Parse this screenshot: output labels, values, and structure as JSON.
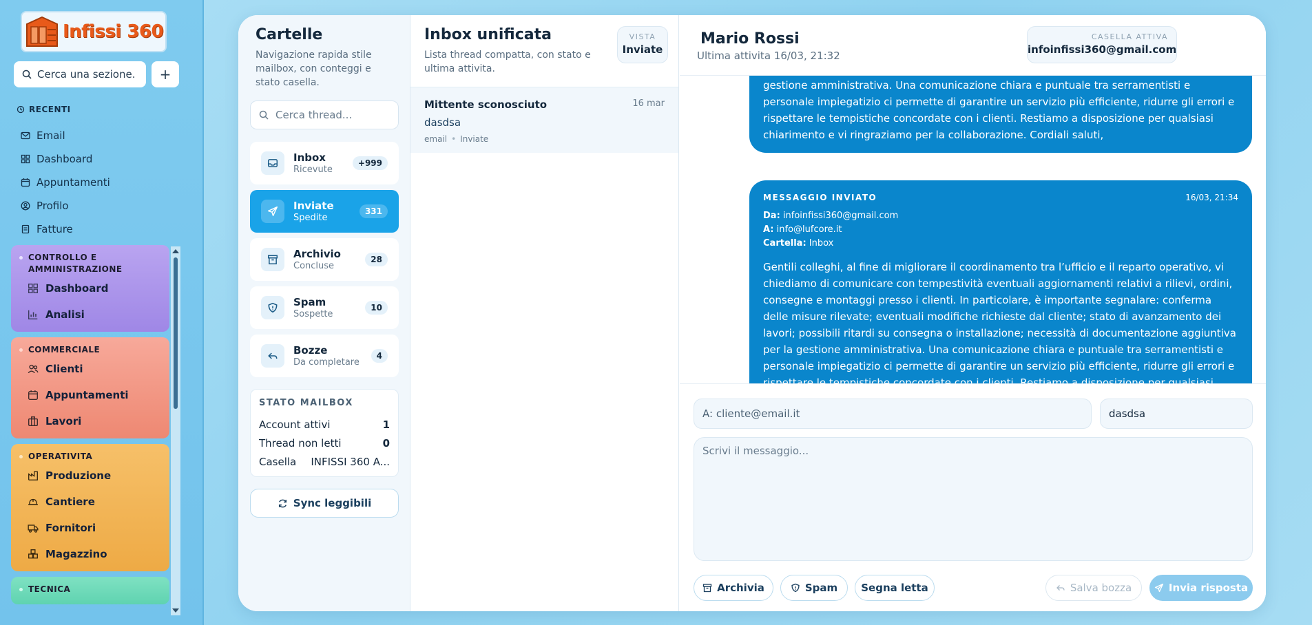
{
  "sidebar": {
    "logo_text": "Infissi 360",
    "search_placeholder": "Cerca una sezione.",
    "plus_label": "+",
    "recent_title": "RECENTI",
    "recent": [
      {
        "label": "Email",
        "icon": "mail-icon"
      },
      {
        "label": "Dashboard",
        "icon": "grid-icon"
      },
      {
        "label": "Appuntamenti",
        "icon": "calendar-icon"
      },
      {
        "label": "Profilo",
        "icon": "user-circle-icon"
      },
      {
        "label": "Fatture",
        "icon": "invoice-icon"
      }
    ],
    "groups": [
      {
        "title": "CONTROLLO E AMMINISTRAZIONE",
        "color": "#9f87e6",
        "items": [
          "Dashboard",
          "Analisi"
        ]
      },
      {
        "title": "COMMERCIALE",
        "color": "#ee8872",
        "items": [
          "Clienti",
          "Appuntamenti",
          "Lavori"
        ]
      },
      {
        "title": "OPERATIVITA",
        "color": "#eeaa45",
        "items": [
          "Produzione",
          "Cantiere",
          "Fornitori",
          "Magazzino"
        ]
      },
      {
        "title": "TECNICA",
        "color": "#5fd3b0",
        "items": []
      }
    ]
  },
  "folders": {
    "title": "Cartelle",
    "subtitle": "Navigazione rapida stile mailbox, con conteggi e stato casella.",
    "search_placeholder": "Cerca thread...",
    "items": [
      {
        "name": "Inbox",
        "desc": "Ricevute",
        "count": "+999",
        "icon": "inbox-icon"
      },
      {
        "name": "Inviate",
        "desc": "Spedite",
        "count": "331",
        "icon": "send-icon",
        "active": true
      },
      {
        "name": "Archivio",
        "desc": "Concluse",
        "count": "28",
        "icon": "archive-icon"
      },
      {
        "name": "Spam",
        "desc": "Sospette",
        "count": "10",
        "icon": "shield-icon"
      },
      {
        "name": "Bozze",
        "desc": "Da completare",
        "count": "4",
        "icon": "reply-icon"
      }
    ],
    "status": {
      "title": "STATO MAILBOX",
      "rows": [
        {
          "label": "Account attivi",
          "value": "1"
        },
        {
          "label": "Thread non letti",
          "value": "0"
        },
        {
          "label": "Casella",
          "value": "INFISSI 360 A..."
        }
      ]
    },
    "sync_label": "Sync leggibili"
  },
  "threads": {
    "title": "Inbox unificata",
    "subtitle": "Lista thread compatta, con stato e ultima attivita.",
    "view_label": "VISTA",
    "view_value": "Inviate",
    "items": [
      {
        "sender": "Mittente sconosciuto",
        "date": "16 mar",
        "subject": "dasdsa",
        "channel": "email",
        "folder": "Inviate"
      }
    ]
  },
  "message": {
    "contact_name": "Mario Rossi",
    "last_activity": "Ultima attivita 16/03, 21:32",
    "box_label": "CASELLA ATTIVA",
    "box_value": "infoinfissi360@gmail.com",
    "bubble1_text": "gestione amministrativa. Una comunicazione chiara e puntuale tra serramentisti e personale impiegatizio ci permette di garantire un servizio più efficiente, ridurre gli errori e rispettare le tempistiche concordate con i clienti. Restiamo a disposizione per qualsiasi chiarimento e vi ringraziamo per la collaborazione. Cordiali saluti,",
    "bubble2": {
      "label": "MESSAGGIO INVIATO",
      "time": "16/03, 21:34",
      "from_label": "Da:",
      "from": "infoinfissi360@gmail.com",
      "to_label": "A:",
      "to": "info@lufcore.it",
      "folder_label": "Cartella:",
      "folder": "Inbox",
      "text": "Gentili colleghi, al fine di migliorare il coordinamento tra l’ufficio e il reparto operativo, vi chiediamo di comunicare con tempestività eventuali aggiornamenti relativi a rilievi, ordini, consegne e montaggi presso i clienti. In particolare, è importante segnalare: conferma delle misure rilevate; eventuali modifiche richieste dal cliente; stato di avanzamento dei lavori; possibili ritardi su consegna o installazione; necessità di documentazione aggiuntiva per la gestione amministrativa. Una comunicazione chiara e puntuale tra serramentisti e personale impiegatizio ci permette di garantire un servizio più efficiente, ridurre gli errori e rispettare le tempistiche concordate con i clienti. Restiamo a disposizione per qualsiasi chiarimento e vi"
    }
  },
  "compose": {
    "to_placeholder": "A: cliente@email.it",
    "subject_value": "dasdsa",
    "body_placeholder": "Scrivi il messaggio...",
    "archive_label": "Archivia",
    "spam_label": "Spam",
    "mark_read_label": "Segna letta",
    "save_draft_label": "Salva bozza",
    "send_label": "Invia risposta"
  },
  "colors": {
    "accent": "#1aa3e8",
    "bubble": "#0a86cc",
    "logo": "#e85a1a"
  }
}
